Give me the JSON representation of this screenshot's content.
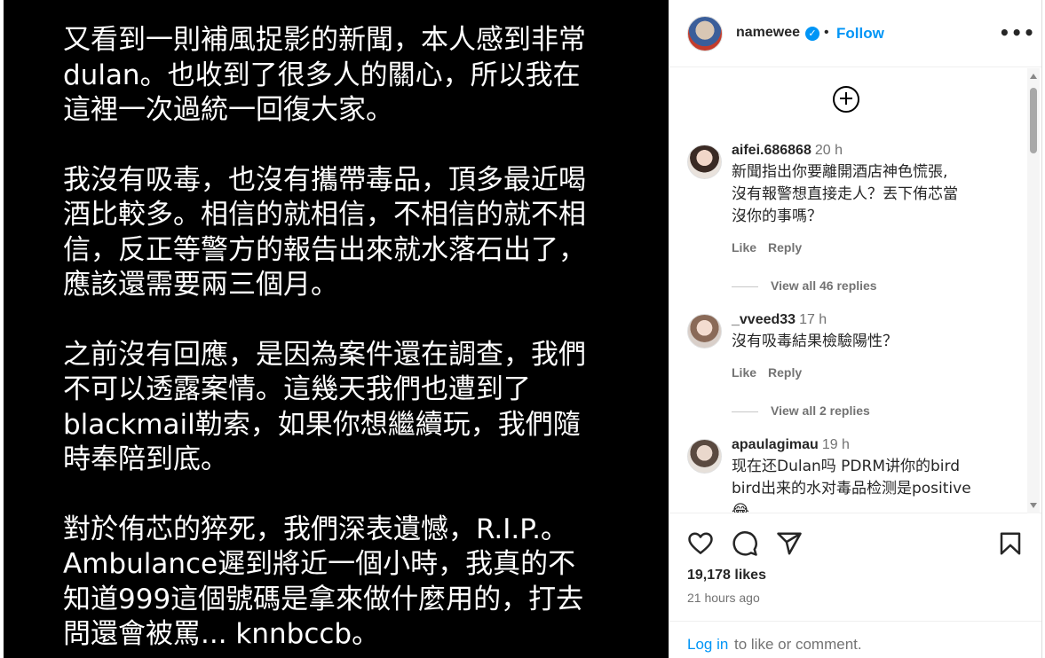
{
  "post": {
    "paragraphs": [
      [
        "又看到一則補風捉影的新聞，本人感到非常",
        "dulan。也收到了很多人的關心，所以我在",
        "這裡一次過統一回復大家。"
      ],
      [
        "我沒有吸毒，也沒有攜帶毒品，頂多最近喝",
        "酒比較多。相信的就相信，不相信的就不相",
        "信，反正等警方的報告出來就水落石出了，",
        "應該還需要兩三個月。"
      ],
      [
        "之前沒有回應，是因為案件還在調查，我們",
        "不可以透露案情。這幾天我們也遭到了",
        "blackmail勒索，如果你想繼續玩，我們隨",
        "時奉陪到底。"
      ],
      [
        "對於侑芯的猝死，我們深表遺憾，R.I.P.。",
        "Ambulance遲到將近一個小時，我真的不",
        "知道999這個號碼是拿來做什麼用的，打去",
        "問還會被罵... knnbccb。"
      ]
    ]
  },
  "header": {
    "username": "namewee",
    "verified_icon": "✓",
    "separator": "•",
    "follow_label": "Follow",
    "more_icon": "•••"
  },
  "comments": [
    {
      "user": "aifei.686868",
      "time": "20 h",
      "lines": [
        "新聞指出你要離開酒店神色慌張,",
        "沒有報警想直接走人？丟下侑芯當",
        "沒你的事嗎？"
      ],
      "like": "Like",
      "reply": "Reply",
      "view_replies": "View all 46 replies"
    },
    {
      "user": "_vveed33",
      "time": "17 h",
      "lines": [
        "沒有吸毒結果檢驗陽性？"
      ],
      "like": "Like",
      "reply": "Reply",
      "view_replies": "View all 2 replies"
    },
    {
      "user": "apaulagimau",
      "time": "19 h",
      "lines": [
        "现在还Dulan吗 PDRM讲你的bird",
        "bird出来的水对毒品检测是positive",
        "😂"
      ]
    }
  ],
  "likes": "19,178 likes",
  "time_ago": "21 hours ago",
  "login": {
    "link": "Log in",
    "rest": "to like or comment."
  },
  "colors": {
    "accent": "#0095f6",
    "text": "#262626",
    "muted": "#737373",
    "post_bg": "#000000"
  }
}
